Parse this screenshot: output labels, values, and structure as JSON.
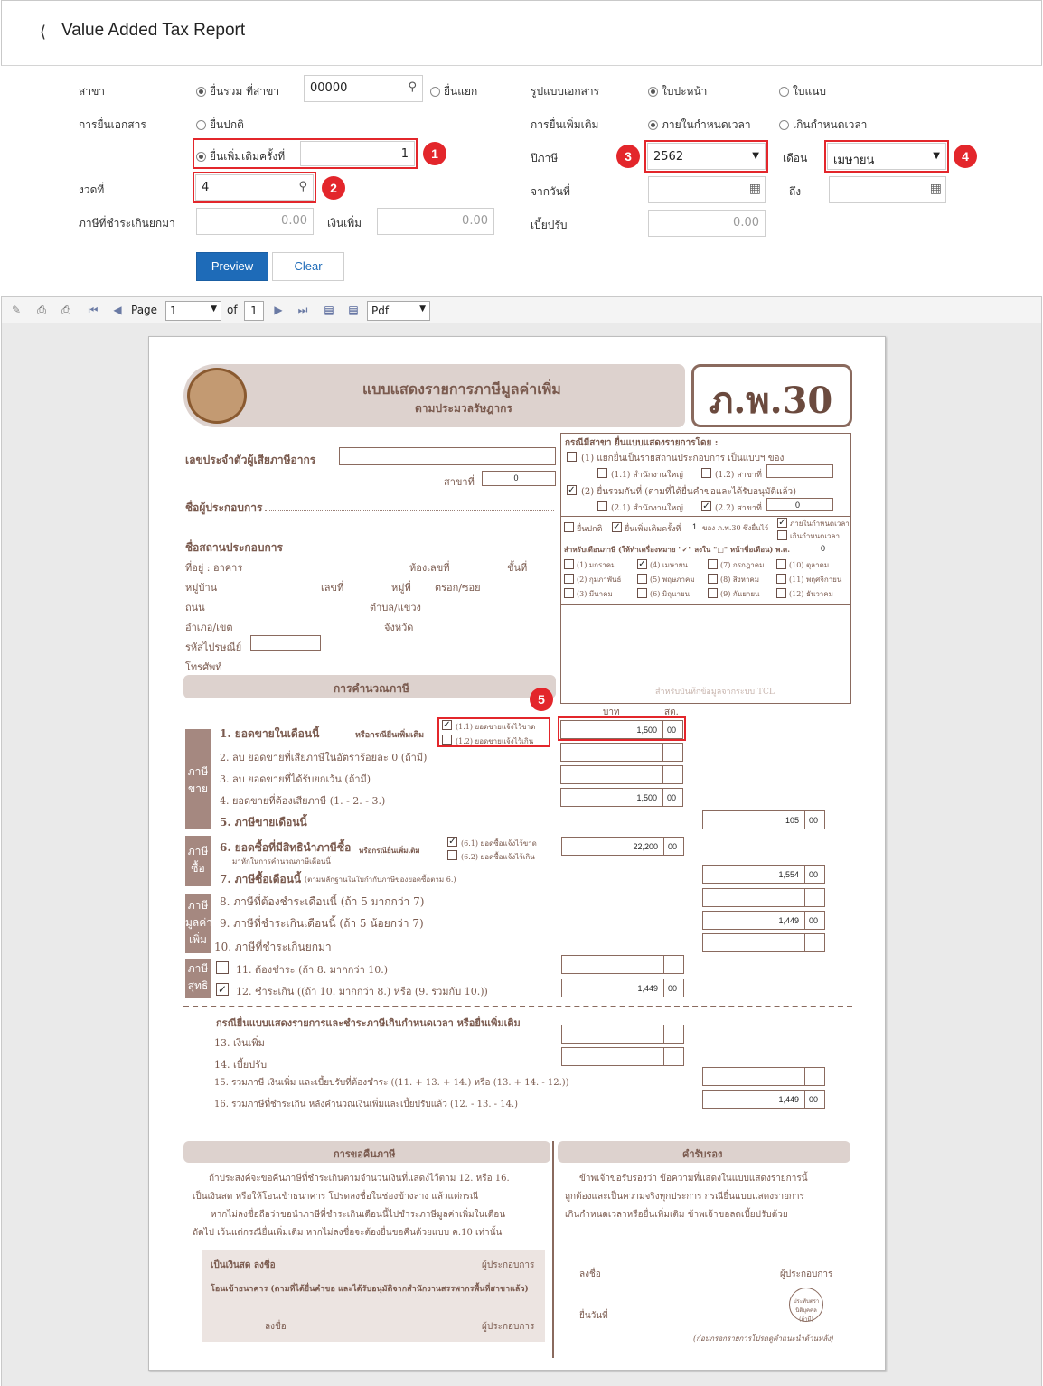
{
  "header": {
    "back_icon": "chevron-left",
    "title": "Value Added Tax Report"
  },
  "form": {
    "branch_label": "สาขา",
    "branch_combined_label": "ยื่นรวม ที่สาขา",
    "branch_code": "00000",
    "branch_separate_label": "ยื่นแยก",
    "doc_format_label": "รูปแบบเอกสาร",
    "doc_format_front": "ใบปะหน้า",
    "doc_format_attach": "ใบแนบ",
    "filing_label": "การยื่นเอกสาร",
    "filing_normal": "ยื่นปกติ",
    "filing_additional": "ยื่นเพิ่มเติมครั้งที่",
    "filing_additional_count": "1",
    "extra_filing_label": "การยื่นเพิ่มเติม",
    "extra_within": "ภายในกำหนดเวลา",
    "extra_over": "เกินกำหนดเวลา",
    "tax_year_label": "ปีภาษี",
    "tax_year": "2562",
    "month_label": "เดือน",
    "month": "เมษายน",
    "period_label": "งวดที่",
    "period": "4",
    "from_date_label": "จากวันที่",
    "to_label": "ถึง",
    "overpaid_label": "ภาษีที่ชำระเกินยกมา",
    "overpaid": "0.00",
    "surcharge_label": "เงินเพิ่ม",
    "surcharge": "0.00",
    "penalty_label": "เบี้ยปรับ",
    "penalty": "0.00",
    "preview_label": "Preview",
    "clear_label": "Clear",
    "badges": [
      "1",
      "2",
      "3",
      "4",
      "5"
    ],
    "accent_color": "#1e6bb8",
    "callout_color": "#e3262b"
  },
  "toolbar": {
    "page_label": "Page",
    "page_value": "1",
    "of_label": "of",
    "total_pages": "1",
    "export_format": "Pdf"
  },
  "report": {
    "title": "แบบแสดงรายการภาษีมูลค่าเพิ่ม",
    "subtitle": "ตามประมวลรัษฎากร",
    "form_code": "ภ.พ.30",
    "taxpayer_id_label": "เลขประจำตัวผู้เสียภาษีอากร",
    "branch_no_label": "สาขาที่",
    "branch_digits": [
      "0",
      "0",
      "0",
      "0",
      "0"
    ],
    "operator_name_label": "ชื่อผู้ประกอบการ",
    "establishment_label": "ชื่อสถานประกอบการ",
    "address_label": "ที่อยู่ : อาคาร",
    "room_label": "ห้องเลขที่",
    "floor_label": "ชั้นที่",
    "village_label": "หมู่บ้าน",
    "house_no_label": "เลขที่",
    "moo_label": "หมู่ที่",
    "soi_label": "ตรอก/ซอย",
    "road_label": "ถนน",
    "subdistrict_label": "ตำบล/แขวง",
    "district_label": "อำเภอ/เขต",
    "province_label": "จังหวัด",
    "postcode_label": "รหัสไปรษณีย์",
    "phone_label": "โทรศัพท์",
    "branch_case_label": "กรณีมีสาขา ยื่นแบบแสดงรายการโดย :",
    "branch_case_1": "(1) แยกยื่นเป็นรายสถานประกอบการ เป็นแบบฯ ของ",
    "branch_case_11": "(1.1) สำนักงานใหญ่",
    "branch_case_12": "(1.2) สาขาที่",
    "branch_case_2": "(2) ยื่นรวมกันที่ (ตามที่ได้ยื่นคำขอและได้รับอนุมัติแล้ว)",
    "branch_case_21": "(2.1) สำนักงานใหญ่",
    "branch_case_22": "(2.2) สาขาที่",
    "normal_label": "ยื่นปกติ",
    "additional_label": "ยื่นเพิ่มเติมครั้งที่",
    "additional_count": "1",
    "additional_suffix": "ของ ภ.พ.30 ซึ่งยื่นไว้",
    "within_time": "ภายในกำหนดเวลา",
    "over_time": "เกินกำหนดเวลา",
    "month_header": "สำหรับเดือนภาษี (ให้ทำเครื่องหมาย \"✓\" ลงใน \"□\" หน้าชื่อเดือน) พ.ศ.",
    "month_header_year": "0",
    "months": [
      "(1) มกราคม",
      "(4) เมษายน",
      "(7) กรกฎาคม",
      "(10) ตุลาคม",
      "(2) กุมภาพันธ์",
      "(5) พฤษภาคม",
      "(8) สิงหาคม",
      "(11) พฤศจิกายน",
      "(3) มีนาคม",
      "(6) มิถุนายน",
      "(9) กันยายน",
      "(12) ธันวาคม"
    ],
    "tcl_note": "สำหรับบันทึกข้อมูลจากระบบ TCL",
    "calc_header": "การคำนวณภาษี",
    "baht_label": "บาท",
    "satang_label": "สต.",
    "side_sale": "ภาษีขาย",
    "side_buy": "ภาษีซื้อ",
    "side_vat": "ภาษีมูลค่าเพิ่ม",
    "side_net": "ภาษีสุทธิ",
    "line1": "1. ยอดขายในเดือนนี้",
    "line1_note": "หรือกรณียื่นเพิ่มเติม",
    "line1_1": "(1.1) ยอดขายแจ้งไว้ขาด",
    "line1_2": "(1.2) ยอดขายแจ้งไว้เกิน",
    "line2": "2. ลบ ยอดขายที่เสียภาษีในอัตราร้อยละ 0 (ถ้ามี)",
    "line3": "3. ลบ ยอดขายที่ได้รับยกเว้น (ถ้ามี)",
    "line4": "4. ยอดขายที่ต้องเสียภาษี (1. - 2. - 3.)",
    "line5": "5. ภาษีขายเดือนนี้",
    "line6": "6. ยอดซื้อที่มีสิทธินำภาษีซื้อ",
    "line6_sub": "มาหักในการคำนวณภาษีเดือนนี้",
    "line6_note": "หรือกรณียื่นเพิ่มเติม",
    "line6_1": "(6.1) ยอดซื้อแจ้งไว้ขาด",
    "line6_2": "(6.2) ยอดซื้อแจ้งไว้เกิน",
    "line7": "7. ภาษีซื้อเดือนนี้",
    "line7_note": "(ตามหลักฐานในใบกำกับภาษีของยอดซื้อตาม 6.)",
    "line8": "8. ภาษีที่ต้องชำระเดือนนี้ (ถ้า 5 มากกว่า 7)",
    "line9": "9. ภาษีที่ชำระเกินเดือนนี้ (ถ้า 5 น้อยกว่า 7)",
    "line10": "10. ภาษีที่ชำระเกินยกมา",
    "line11": "11. ต้องชำระ (ถ้า 8. มากกว่า 10.)",
    "line12": "12. ชำระเกิน ((ถ้า 10. มากกว่า 8.) หรือ (9. รวมกับ 10.))",
    "late_header": "กรณียื่นแบบแสดงรายการและชำระภาษีเกินกำหนดเวลา หรือยื่นเพิ่มเติม",
    "line13": "13. เงินเพิ่ม",
    "line14": "14. เบี้ยปรับ",
    "line15": "15. รวมภาษี เงินเพิ่ม และเบี้ยปรับที่ต้องชำระ ((11. + 13. + 14.) หรือ (13. + 14. - 12.))",
    "line16": "16. รวมภาษีที่ชำระเกิน หลังคำนวณเงินเพิ่มและเบี้ยปรับแล้ว (12. - 13. - 14.)",
    "values": {
      "l1_baht": "1,500",
      "l1_satang": "00",
      "l4_baht": "1,500",
      "l4_satang": "00",
      "l5_baht": "105",
      "l5_satang": "00",
      "l6_baht": "22,200",
      "l6_satang": "00",
      "l7_baht": "1,554",
      "l7_satang": "00",
      "l9_baht": "1,449",
      "l9_satang": "00",
      "l12_baht": "1,449",
      "l12_satang": "00",
      "l16_baht": "1,449",
      "l16_satang": "00"
    },
    "refund_header": "การขอคืนภาษี",
    "refund_text1": "ถ้าประสงค์จะขอคืนภาษีที่ชำระเกินตามจำนวนเงินที่แสดงไว้ตาม 12. หรือ 16.",
    "refund_text2": "เป็นเงินสด หรือให้โอนเข้าธนาคาร โปรดลงชื่อในช่องข้างล่าง แล้วแต่กรณี",
    "refund_text3": "หากไม่ลงชื่อถือว่าขอนำภาษีที่ชำระเกินเดือนนี้ไปชำระภาษีมูลค่าเพิ่มในเดือน",
    "refund_text4": "ถัดไป เว้นแต่กรณียื่นเพิ่มเติม หากไม่ลงชื่อจะต้องยื่นขอคืนด้วยแบบ ค.10 เท่านั้น",
    "refund_cash": "เป็นเงินสด ลงชื่อ",
    "refund_operator": "ผู้ประกอบการ",
    "refund_bank": "โอนเข้าธนาคาร (ตามที่ได้ยื่นคำขอ และได้รับอนุมัติจากสำนักงานสรรพากรพื้นที่สาขาแล้ว)",
    "refund_sign": "ลงชื่อ",
    "cert_header": "คำรับรอง",
    "cert_text1": "ข้าพเจ้าขอรับรองว่า ข้อความที่แสดงในแบบแสดงรายการนี้",
    "cert_text2": "ถูกต้องและเป็นความจริงทุกประการ กรณียื่นแบบแสดงรายการ",
    "cert_text3": "เกินกำหนดเวลาหรือยื่นเพิ่มเติม ข้าพเจ้าขอลดเบี้ยปรับด้วย",
    "cert_sign": "ลงชื่อ",
    "cert_operator": "ผู้ประกอบการ",
    "cert_date": "ยื่นวันที่",
    "stamp": "ประทับตรา นิติบุคคล (ถ้ามี)",
    "footnote": "(ก่อนกรอกรายการโปรดดูคำแนะนำด้านหลัง)"
  }
}
